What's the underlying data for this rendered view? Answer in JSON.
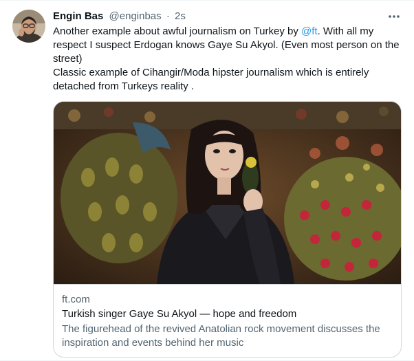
{
  "author": {
    "display_name": "Engin Bas",
    "handle": "@enginbas",
    "separator": "·",
    "timestamp": "2s"
  },
  "icons": {
    "more": "more-horizontal-icon",
    "avatar": "profile-avatar"
  },
  "tweet": {
    "line1_prefix": "Another example about awful journalism on Turkey by ",
    "mention": "@ft",
    "line1_suffix": ". With all my respect I suspect Erdogan knows Gaye Su Akyol. (Even most person on the street)",
    "line2": "Classic example of Cihangir/Moda hipster journalism which is entirely detached from Turkeys reality ."
  },
  "card": {
    "domain": "ft.com",
    "title": "Turkish singer Gaye Su Akyol — hope and freedom",
    "description": "The figurehead of the revived Anatolian rock movement discusses the inspiration and events behind her music"
  },
  "colors": {
    "link": "#1d9bf0",
    "secondary_text": "#536471",
    "primary_text": "#0f1419",
    "border": "#cfd9de"
  }
}
